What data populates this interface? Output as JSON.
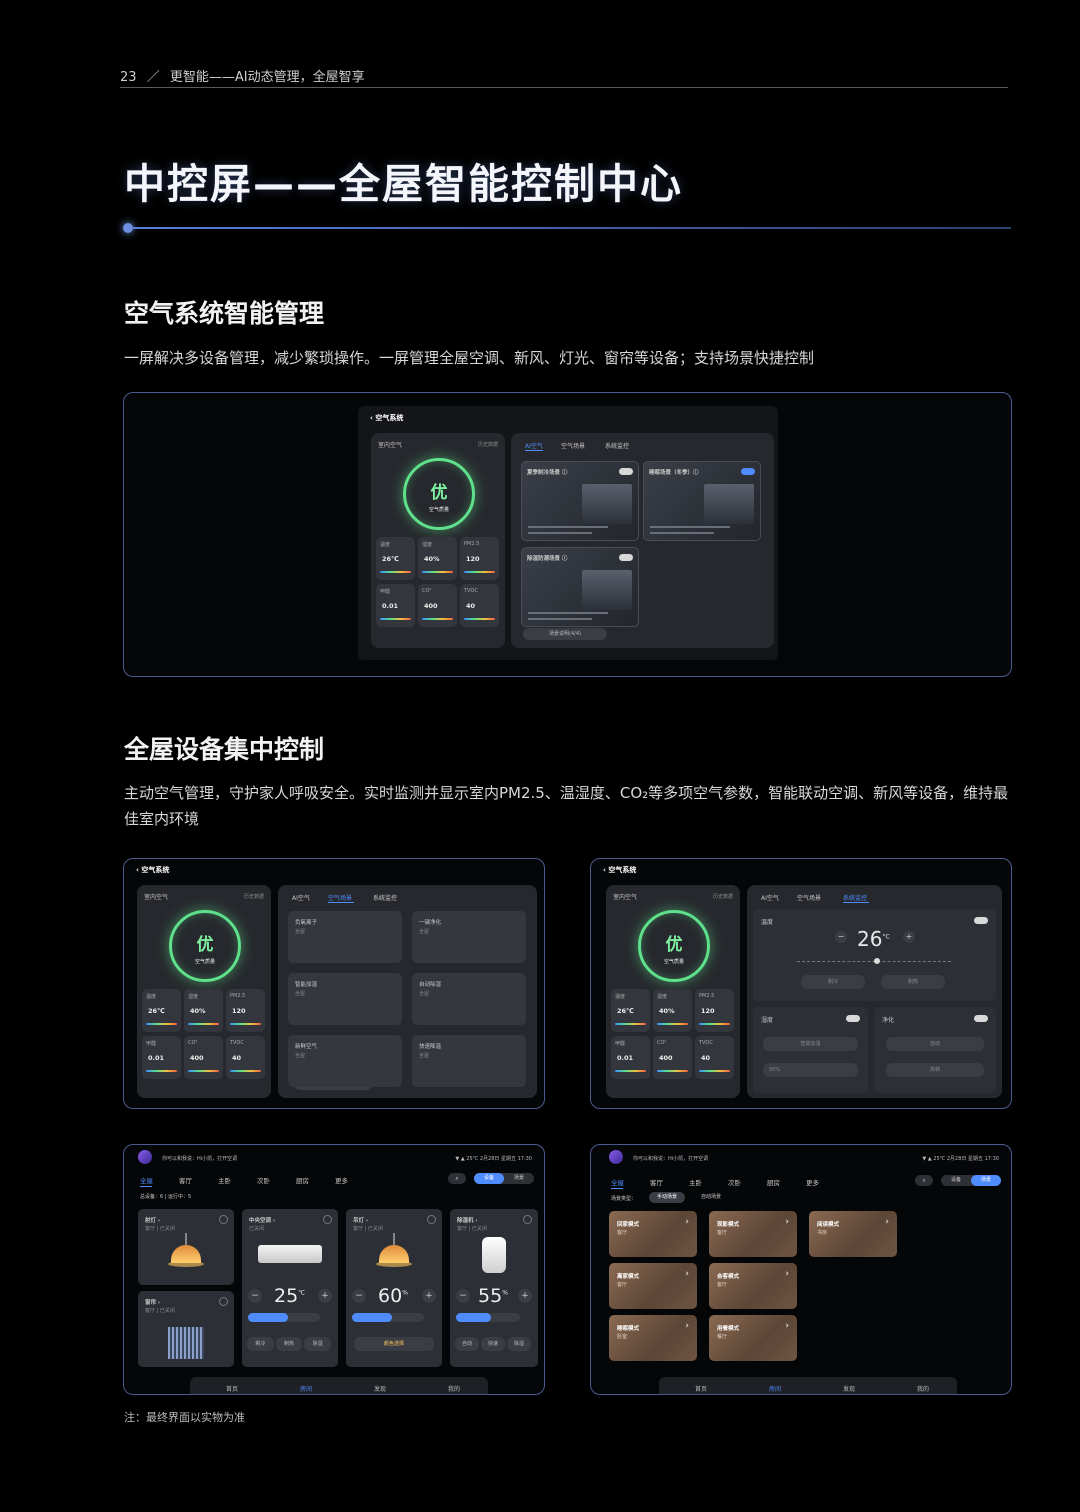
{
  "header": {
    "page_num": "23",
    "sep": "／",
    "section": "更智能——AI动态管理，全屋智享"
  },
  "title": "中控屏——全屋智能控制中心",
  "section1": {
    "heading": "空气系统智能管理",
    "desc": "一屏解决多设备管理，减少繁琐操作。一屏管理全屋空调、新风、灯光、窗帘等设备；支持场景快捷控制"
  },
  "section2": {
    "heading": "全屋设备集中控制",
    "desc": "主动空气管理，守护家人呼吸安全。实时监测并显示室内PM2.5、温湿度、CO₂等多项空气参数，智能联动空调、新风等设备，维持最佳室内环境"
  },
  "air_mock": {
    "back": "‹ 空气系统",
    "indoor": "室内空气",
    "history": "历史数据",
    "quality": "优",
    "quality_sub": "空气质量",
    "metrics": [
      {
        "label": "温度",
        "value": "26℃"
      },
      {
        "label": "湿度",
        "value": "40%"
      },
      {
        "label": "PM2.5",
        "value": "120"
      },
      {
        "label": "甲醛",
        "value": "0.01"
      },
      {
        "label": "CO²",
        "value": "400"
      },
      {
        "label": "TVOC",
        "value": "40"
      }
    ],
    "tabs": [
      "AI空气",
      "空气场景",
      "系统监控"
    ],
    "scenes": [
      {
        "name": "夏季制冷场景 ⓘ",
        "on": false
      },
      {
        "name": "睡眠场景（冬季）ⓘ",
        "on": true
      },
      {
        "name": "除湿防潮场景 ⓘ",
        "on": false
      }
    ],
    "scene_btn": "场景说明(4/4)",
    "scene_tiles": [
      {
        "name": "负氧离子",
        "sub": "全屋"
      },
      {
        "name": "一键净化",
        "sub": "全屋"
      },
      {
        "name": "智能加湿",
        "sub": "全屋"
      },
      {
        "name": "自动除湿",
        "sub": "全屋"
      },
      {
        "name": "新鲜空气",
        "sub": "全屋"
      },
      {
        "name": "快速降温",
        "sub": "全屋"
      }
    ],
    "monitor": {
      "temp_label": "温度",
      "temp_value": "26",
      "temp_unit": "°C",
      "humidity_label": "湿度",
      "purify_label": "净化",
      "btn_cool": "制冷",
      "btn_heat": "制热",
      "btn_smart_hum": "智能加湿",
      "btn_auto": "自动",
      "btn_high": "高档",
      "hum_level": "50%"
    }
  },
  "device_mock": {
    "greeting": "你可以和我说：Hi小凯，打开空调",
    "status": "▼ ▲ 25℃  2月28日 星期五  17:30",
    "rooms": [
      "全屋",
      "客厅",
      "主卧",
      "次卧",
      "厨房",
      "更多"
    ],
    "seg": [
      "设备",
      "场景"
    ],
    "summary": "总设备：6 | 运行中：5",
    "devices": [
      {
        "name": "射灯 ›",
        "sub": "客厅 | 已关闭"
      },
      {
        "name": "中央空调 ›",
        "sub": "已关闭",
        "value": "25",
        "unit": "℃"
      },
      {
        "name": "吊灯 ›",
        "sub": "客厅 | 已关闭",
        "value": "60",
        "unit": "%"
      },
      {
        "name": "除湿机 ›",
        "sub": "客厅 | 已关闭",
        "value": "55",
        "unit": "%"
      },
      {
        "name": "窗帘 ›",
        "sub": "客厅 | 已关闭"
      }
    ],
    "ac_modes": [
      "制冷",
      "制热",
      "除湿"
    ],
    "dh_modes": [
      "自动",
      "快速",
      "除湿"
    ],
    "lamp_btn": "颜色选择",
    "nav": [
      "首页",
      "房间",
      "发现",
      "我的"
    ]
  },
  "scene_mock": {
    "greeting": "你可以和我说：Hi小凯，打开空调",
    "status": "▼ ▲ 25℃  2月28日 星期五  17:30",
    "rooms": [
      "全屋",
      "客厅",
      "主卧",
      "次卧",
      "厨房",
      "更多"
    ],
    "seg": [
      "设备",
      "场景"
    ],
    "filter_label": "场景类型：",
    "filters": [
      "手动场景",
      "自动场景"
    ],
    "modes": [
      {
        "name": "回家模式",
        "sub": "客厅"
      },
      {
        "name": "观影模式",
        "sub": "客厅"
      },
      {
        "name": "阅读模式",
        "sub": "书房"
      },
      {
        "name": "离家模式",
        "sub": "客厅"
      },
      {
        "name": "会客模式",
        "sub": "客厅"
      },
      {
        "name": "睡眠模式",
        "sub": "卧室"
      },
      {
        "name": "用餐模式",
        "sub": "餐厅"
      }
    ],
    "nav": [
      "首页",
      "房间",
      "发现",
      "我的"
    ]
  },
  "note": "注：最终界面以实物为准"
}
